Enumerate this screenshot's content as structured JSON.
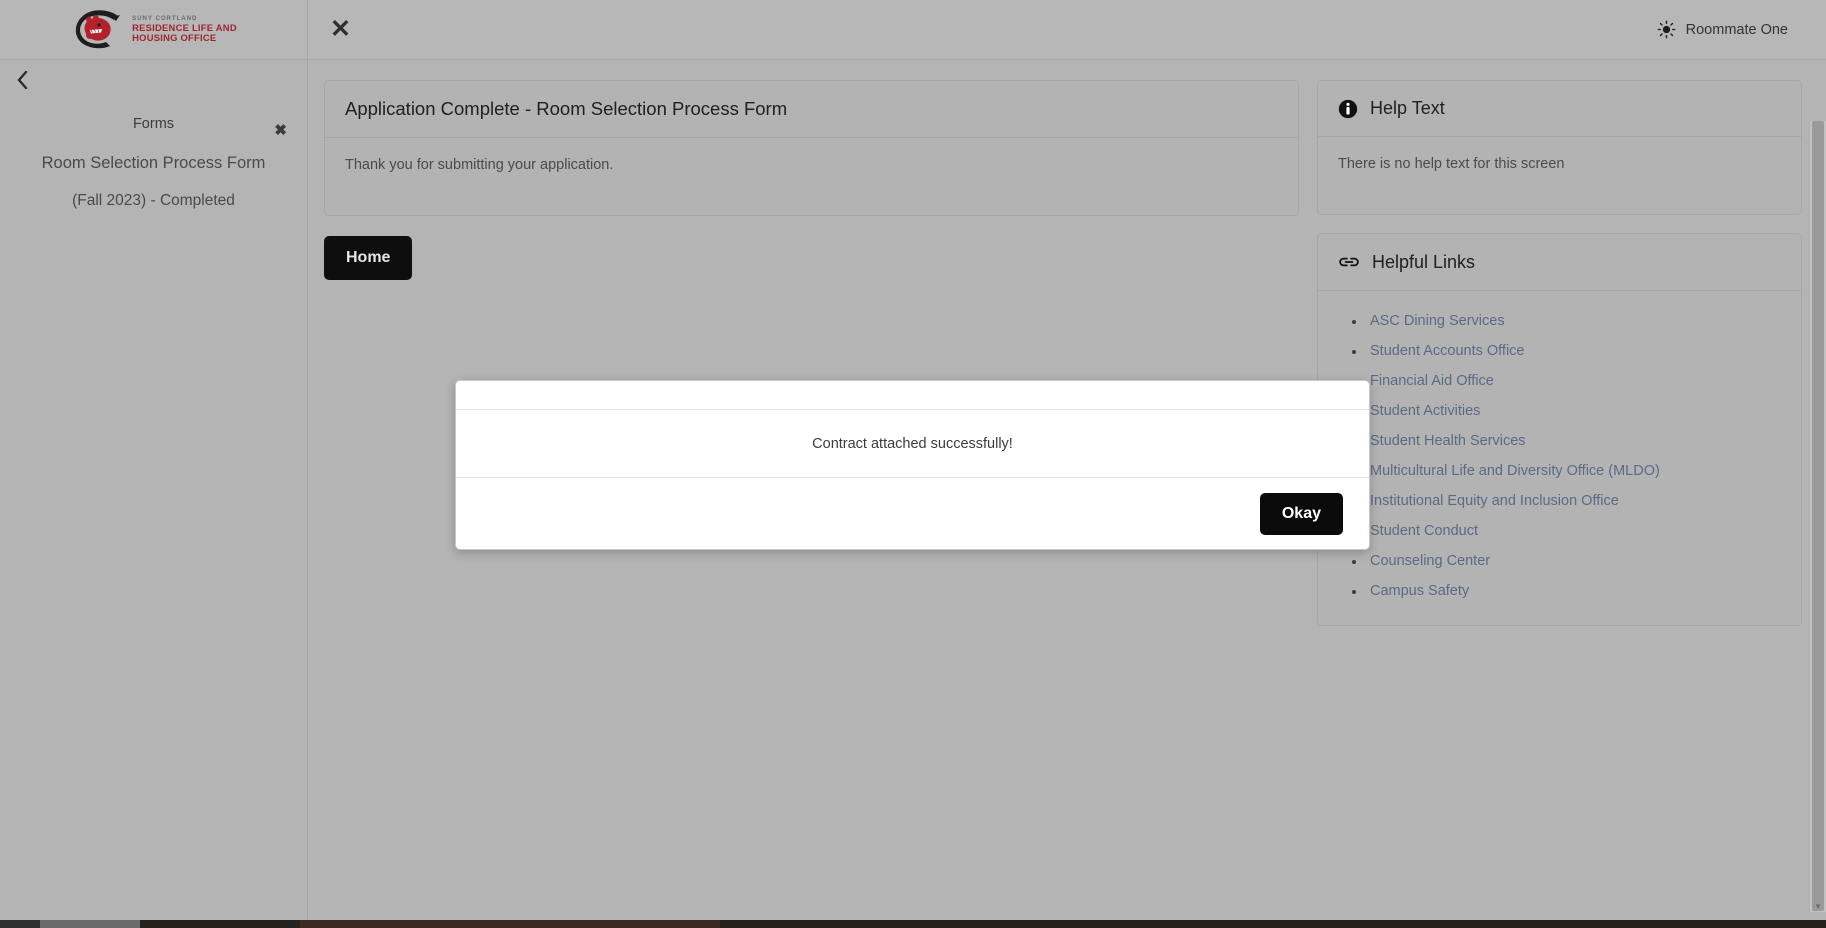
{
  "topbar": {
    "logo": {
      "icon": "dragon-head-logo",
      "sub": "SUNY CORTLAND",
      "line1": "RESIDENCE LIFE AND",
      "line2": "HOUSING OFFICE",
      "brand_red": "#9e2430"
    },
    "close_label": "✕",
    "theme_icon": "sun-icon",
    "user_name": "Roommate One"
  },
  "sidebar": {
    "collapse_icon": "chevron-left-icon",
    "close_label": "✖",
    "heading": "Forms",
    "form_name": "Room Selection Process Form",
    "form_status": "(Fall 2023) - Completed"
  },
  "main": {
    "title": "Application Complete - Room Selection Process Form",
    "message": "Thank you for submitting your application.",
    "home_button": "Home"
  },
  "help": {
    "icon": "info-icon",
    "title": "Help Text",
    "text": "There is no help text for this screen"
  },
  "helpful_links": {
    "icon": "link-icon",
    "title": "Helpful Links",
    "items": [
      "ASC Dining Services",
      "Student Accounts Office",
      "Financial Aid Office",
      "Student Activities",
      "Student Health Services",
      "Multicultural Life and Diversity Office (MLDO)",
      "Institutional Equity and Inclusion Office",
      "Student Conduct",
      "Counseling Center",
      "Campus Safety"
    ],
    "link_color": "#5a6a85"
  },
  "modal": {
    "message": "Contract attached successfully!",
    "okay_label": "Okay"
  },
  "scrollbar": {
    "arrow_down": "▾"
  }
}
